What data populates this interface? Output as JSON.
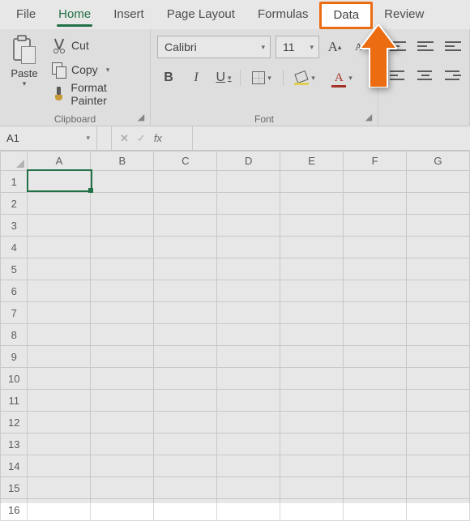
{
  "tabs": {
    "file": "File",
    "home": "Home",
    "insert": "Insert",
    "page_layout": "Page Layout",
    "formulas": "Formulas",
    "data": "Data",
    "review": "Review"
  },
  "clipboard": {
    "paste": "Paste",
    "cut": "Cut",
    "copy": "Copy",
    "format_painter": "Format Painter",
    "group_label": "Clipboard"
  },
  "font": {
    "name": "Calibri",
    "size": "11",
    "bold": "B",
    "italic": "I",
    "underline": "U",
    "fontcolor_letter": "A",
    "grow": "A",
    "shrink": "A",
    "group_label": "Font"
  },
  "namebox": {
    "value": "A1"
  },
  "formula_bar": {
    "fx": "fx",
    "value": ""
  },
  "grid": {
    "cols": [
      "A",
      "B",
      "C",
      "D",
      "E",
      "F",
      "G"
    ],
    "rows": [
      "1",
      "2",
      "3",
      "4",
      "5",
      "6",
      "7",
      "8",
      "9",
      "10",
      "11",
      "12",
      "13",
      "14",
      "15",
      "16"
    ]
  },
  "active_cell": {
    "col": "A",
    "row": "1"
  }
}
